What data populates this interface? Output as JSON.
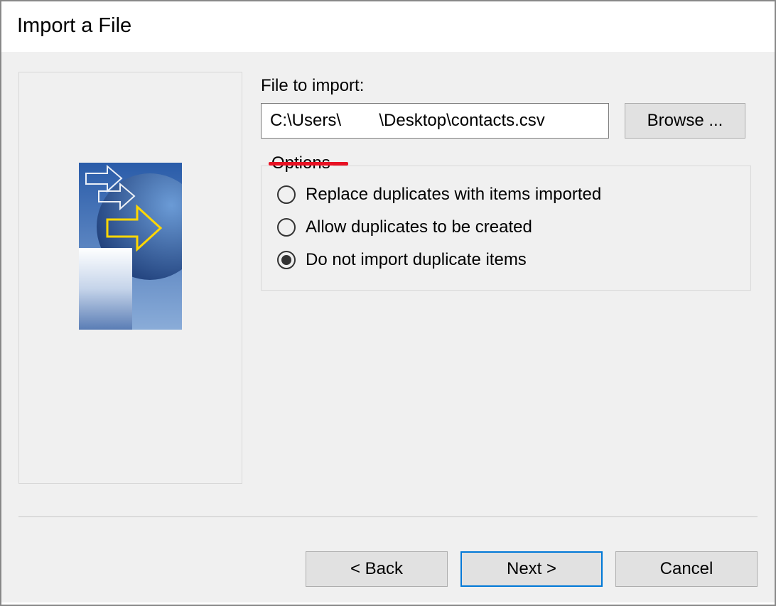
{
  "window": {
    "title": "Import a File"
  },
  "form": {
    "file_label": "File to import:",
    "file_value": "C:\\Users\\        \\Desktop\\contacts.csv",
    "browse_label": "Browse ..."
  },
  "options": {
    "legend": "Options",
    "items": [
      {
        "label": "Replace duplicates with items imported",
        "selected": false
      },
      {
        "label": "Allow duplicates to be created",
        "selected": false
      },
      {
        "label": "Do not import duplicate items",
        "selected": true
      }
    ]
  },
  "buttons": {
    "back": "< Back",
    "next": "Next >",
    "cancel": "Cancel"
  }
}
